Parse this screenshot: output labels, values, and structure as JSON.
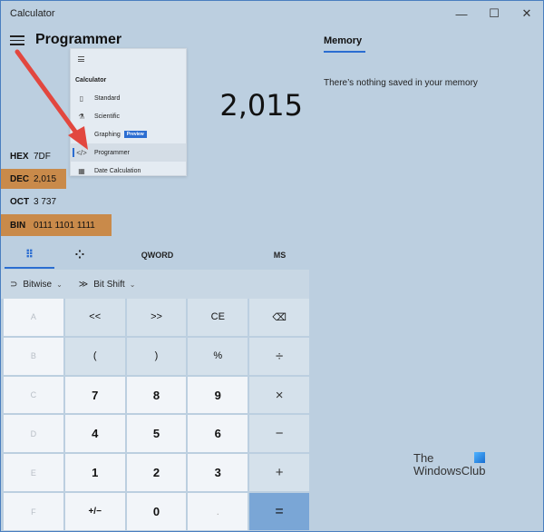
{
  "window": {
    "title": "Calculator",
    "controls": {
      "minimize": "—",
      "maximize": "☐",
      "close": "✕"
    }
  },
  "header": {
    "menu_icon": "hamburger-icon",
    "mode": "Programmer"
  },
  "display": {
    "value": "2,015"
  },
  "radix": [
    {
      "label": "HEX",
      "value": "7DF",
      "highlighted": false
    },
    {
      "label": "DEC",
      "value": "2,015",
      "highlighted": true
    },
    {
      "label": "OCT",
      "value": "3 737",
      "highlighted": false
    },
    {
      "label": "BIN",
      "value": "0111 1101 1111",
      "highlighted": true
    }
  ],
  "nav_menu": {
    "header": "Calculator",
    "items": [
      {
        "label": "Standard",
        "icon": "▯"
      },
      {
        "label": "Scientific",
        "icon": "⚗"
      },
      {
        "label": "Graphing",
        "icon": "⟋",
        "badge": "Preview"
      },
      {
        "label": "Programmer",
        "icon": "</>",
        "selected": true
      },
      {
        "label": "Date Calculation",
        "icon": "▦"
      }
    ]
  },
  "tabs": {
    "keypad_icon": "⠿",
    "bits_icon": "⁘",
    "word_size": "QWORD",
    "memory_store": "MS"
  },
  "operations": {
    "bitwise": {
      "label": "Bitwise",
      "icon": "⊃",
      "chevron": "⌄"
    },
    "bitshift": {
      "label": "Bit Shift",
      "icon": "≫",
      "chevron": "⌄"
    }
  },
  "keypad": [
    [
      "A",
      "<<",
      ">>",
      "CE",
      "⌫"
    ],
    [
      "B",
      "(",
      ")",
      "%",
      "÷"
    ],
    [
      "C",
      "7",
      "8",
      "9",
      "×"
    ],
    [
      "D",
      "4",
      "5",
      "6",
      "−"
    ],
    [
      "E",
      "1",
      "2",
      "3",
      "+"
    ],
    [
      "F",
      "+/−",
      "0",
      ".",
      "="
    ]
  ],
  "memory": {
    "title": "Memory",
    "empty_message": "There’s nothing saved in your memory"
  },
  "watermark": {
    "line1": "The",
    "line2": "WindowsClub"
  },
  "colors": {
    "accent": "#2b6dd1",
    "highlight": "#c98a4a",
    "equals": "#7aa6d6",
    "arrow": "#e2473f"
  }
}
